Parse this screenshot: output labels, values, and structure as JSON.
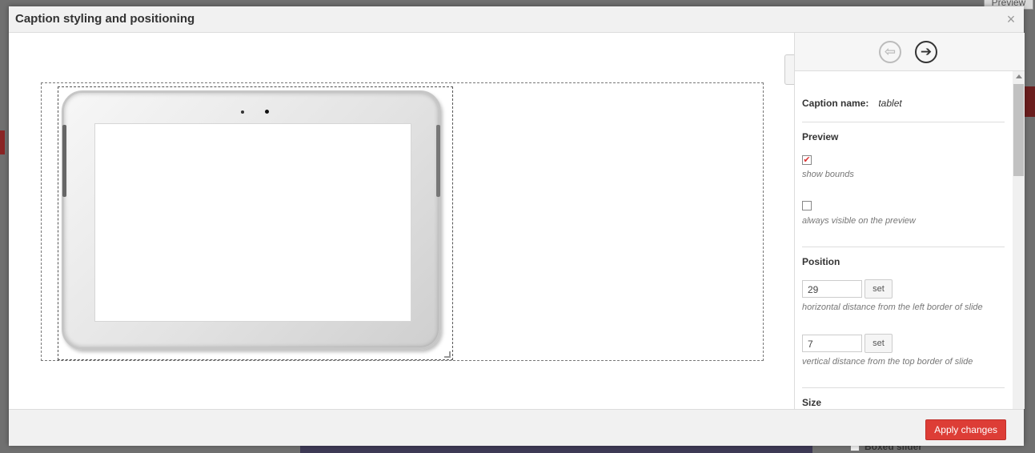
{
  "background": {
    "preview_label": "Preview",
    "boxed_slider_label": "Boxed slider"
  },
  "modal": {
    "title": "Caption styling and positioning",
    "close_icon": "×"
  },
  "nav": {
    "prev_icon": "arrow-left-circle",
    "next_icon": "arrow-right-circle",
    "prev_glyph": "⇦",
    "next_glyph": "➔"
  },
  "caption": {
    "name_label": "Caption name:",
    "name_value": "tablet"
  },
  "preview": {
    "title": "Preview",
    "show_bounds_label": "show bounds",
    "show_bounds_checked": true,
    "always_visible_label": "always visible on the preview",
    "always_visible_checked": false
  },
  "position": {
    "title": "Position",
    "horizontal_value": "29",
    "horizontal_hint": "horizontal distance from the left border of slide",
    "vertical_value": "7",
    "vertical_hint": "vertical distance from the top border of slide",
    "set_label": "set"
  },
  "size": {
    "title": "Size"
  },
  "footer": {
    "apply_label": "Apply changes"
  },
  "colors": {
    "accent": "#dd3d36",
    "checkmark": "#d33333"
  }
}
